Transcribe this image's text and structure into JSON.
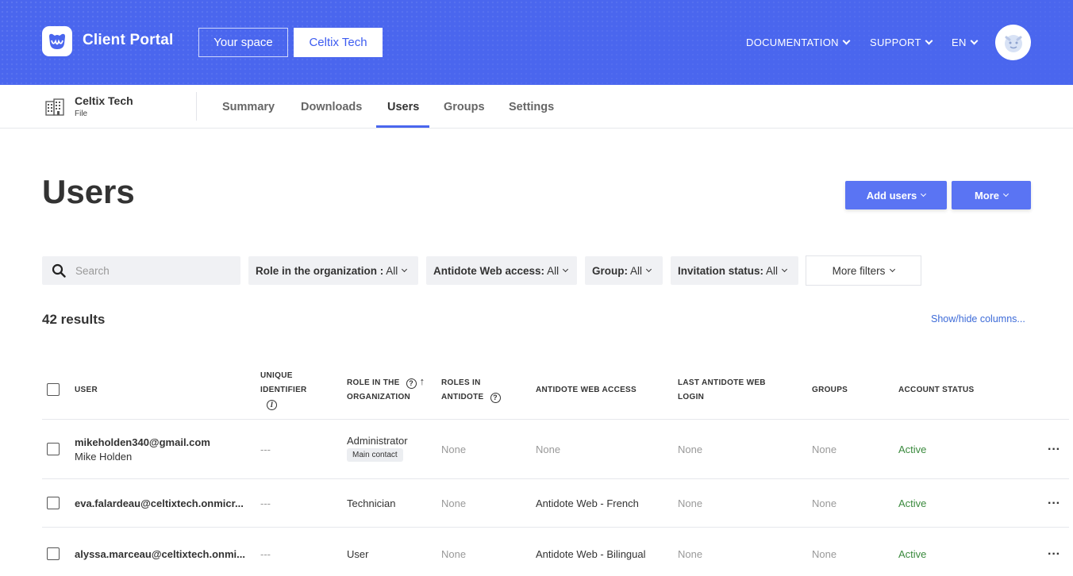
{
  "header": {
    "brand": "Client Portal",
    "space_buttons": [
      "Your space",
      "Celtix Tech"
    ],
    "nav": [
      "DOCUMENTATION",
      "SUPPORT",
      "EN"
    ]
  },
  "subnav": {
    "org_name": "Celtix Tech",
    "org_type": "File",
    "tabs": [
      "Summary",
      "Downloads",
      "Users",
      "Groups",
      "Settings"
    ],
    "active_tab": "Users"
  },
  "main": {
    "title": "Users",
    "add_users_label": "Add users",
    "more_label": "More",
    "search_placeholder": "Search",
    "filters": [
      {
        "label": "Role in the organization :",
        "value": "All"
      },
      {
        "label": "Antidote Web access:",
        "value": "All"
      },
      {
        "label": "Group:",
        "value": "All"
      },
      {
        "label": "Invitation status:",
        "value": "All"
      }
    ],
    "more_filters_label": "More filters",
    "results_label": "42 results",
    "show_hide_label": "Show/hide columns..."
  },
  "table": {
    "columns": {
      "user": "USER",
      "unique_id_1": "UNIQUE",
      "unique_id_2": "IDENTIFIER",
      "role_org_1": "ROLE IN THE",
      "role_org_2": "ORGANIZATION",
      "roles_antidote_1": "ROLES IN",
      "roles_antidote_2": "ANTIDOTE",
      "web_access": "ANTIDOTE WEB ACCESS",
      "last_login_1": "LAST ANTIDOTE WEB",
      "last_login_2": "LOGIN",
      "groups": "GROUPS",
      "account_status": "ACCOUNT STATUS"
    },
    "rows": [
      {
        "email": "mikeholden340@gmail.com",
        "name": "Mike Holden",
        "unique_id": "---",
        "role": "Administrator",
        "badge": "Main contact",
        "roles_antidote": "None",
        "web_access": "None",
        "last_login": "None",
        "groups": "None",
        "status": "Active"
      },
      {
        "email": "eva.falardeau@celtixtech.onmicr...",
        "name": "",
        "unique_id": "---",
        "role": "Technician",
        "badge": "",
        "roles_antidote": "None",
        "web_access": "Antidote Web - French",
        "last_login": "None",
        "groups": "None",
        "status": "Active"
      },
      {
        "email": "alyssa.marceau@celtixtech.onmi...",
        "name": "",
        "unique_id": "---",
        "role": "User",
        "badge": "",
        "roles_antidote": "None",
        "web_access": "Antidote Web - Bilingual",
        "last_login": "None",
        "groups": "None",
        "status": "Active"
      }
    ]
  },
  "colors": {
    "header_blue": "#4a66ee",
    "button_blue": "#5a74f3",
    "active_green": "#3b8a3e",
    "link_blue": "#3d6bd8"
  },
  "icons": [
    "logo-icon",
    "avatar-icon",
    "building-icon",
    "search-icon",
    "info-icon",
    "help-icon",
    "sort-arrow-up-icon",
    "chevron-down-icon",
    "kebab-menu-icon"
  ]
}
